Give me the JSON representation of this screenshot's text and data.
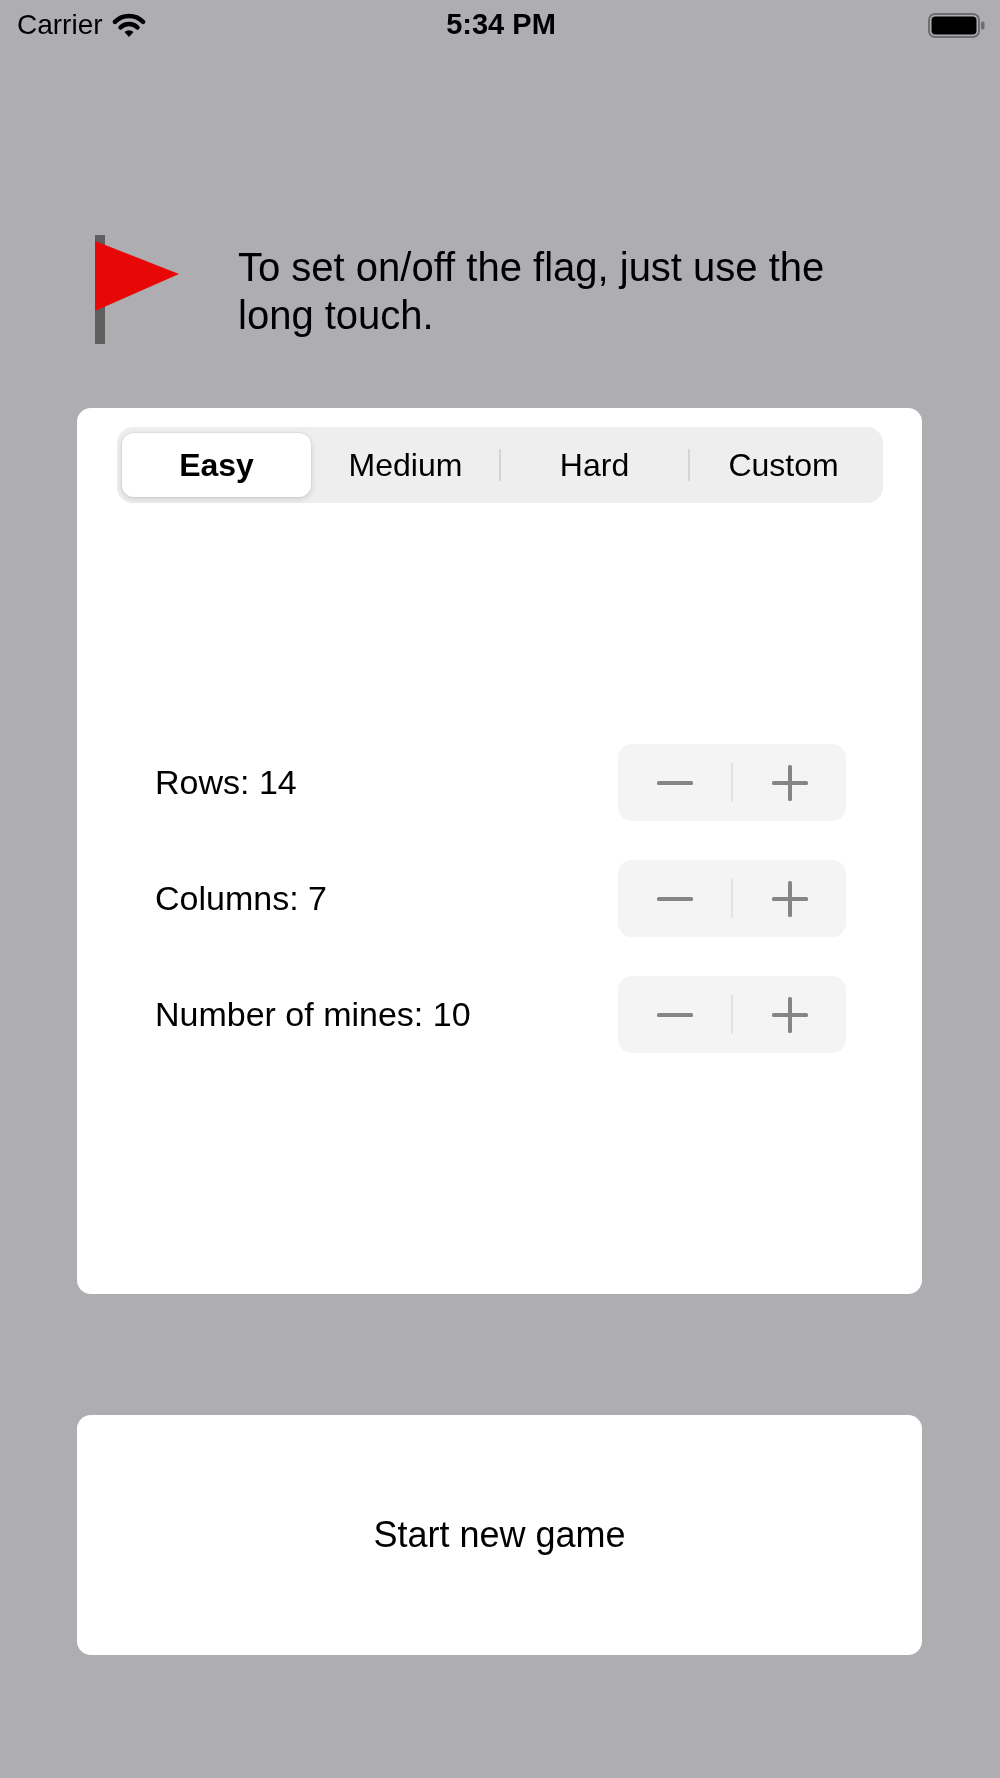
{
  "status_bar": {
    "carrier": "Carrier",
    "time": "5:34 PM"
  },
  "hint": {
    "text": "To set on/off the flag, just use the long touch."
  },
  "difficulty_tabs": [
    {
      "label": "Easy",
      "selected": true
    },
    {
      "label": "Medium",
      "selected": false
    },
    {
      "label": "Hard",
      "selected": false
    },
    {
      "label": "Custom",
      "selected": false
    }
  ],
  "settings": [
    {
      "label": "Rows: 14"
    },
    {
      "label": "Columns: 7"
    },
    {
      "label": "Number of mines: 10"
    }
  ],
  "start_button": {
    "label": "Start new game"
  }
}
